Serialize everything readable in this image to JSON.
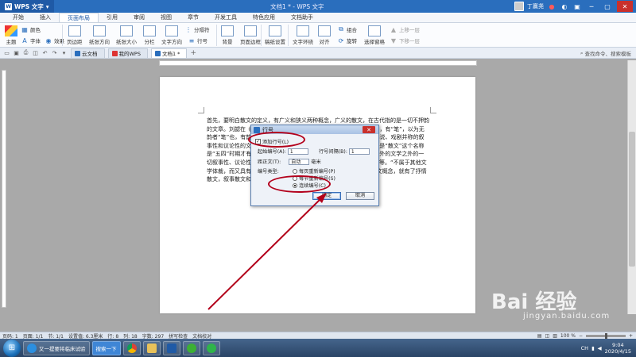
{
  "titlebar": {
    "app_menu_label": "WPS 文字",
    "doc_title": "文档1 * - WPS 文字",
    "user_name": "丁赢尧"
  },
  "menu_tabs": [
    {
      "label": "开始",
      "active": false
    },
    {
      "label": "插入",
      "active": false
    },
    {
      "label": "页面布局",
      "active": true
    },
    {
      "label": "引用",
      "active": false
    },
    {
      "label": "审阅",
      "active": false
    },
    {
      "label": "视图",
      "active": false
    },
    {
      "label": "章节",
      "active": false
    },
    {
      "label": "开发工具",
      "active": false
    },
    {
      "label": "特色应用",
      "active": false
    },
    {
      "label": "文档助手",
      "active": false
    }
  ],
  "ribbon": {
    "color": "颜色",
    "theme": "主题",
    "font": "字体",
    "effect": "效果",
    "margins": "页边距",
    "orientation": "纸张方向",
    "paper_size": "纸张大小",
    "columns": "分栏",
    "text_direction": "文字方向",
    "breaks": "分隔符",
    "line_numbers": "行号",
    "background": "背景",
    "page_border": "页面边框",
    "draft_paper": "稿纸设置",
    "text_wrap": "文字环绕",
    "align": "对齐",
    "group": "组合",
    "rotate": "旋转",
    "selection_pane": "选择窗格",
    "bring_forward": "上移一层",
    "send_backward": "下移一层"
  },
  "tabstrip": {
    "tabs": [
      {
        "label": "云文档"
      },
      {
        "label": "我的WPS"
      },
      {
        "label": "文档1 *"
      }
    ],
    "add_tab": "+",
    "command_search": "查找命令、搜索模板"
  },
  "document": {
    "text": "首先，要明白散文的定义，有广义和狭义两种概念，广义的散文，在古代指的是一切不押韵的文章。刘勰在《文心雕龙》中，将有韵的称为“文”，无韵的称为“笔”，有“笔”，以为无韵者“笔”也，有韵者“文”也。至于近代以来的散文，则多指与诗歌、小说、戏剧并称的叙事性和议论性的文体，这些文体是散文的主要部分。散文中“散”的含义是“散文”这个名称是“五四”时期才有的。在现代，广义的散文是指除诗歌、小说、戏剧以外的文学之外的一切叙事性、议论性、抒情性的文体，包括杂文、小品、随笔、报告文学等。“不属于其他文学体裁，而又具有文学性的散行文章”，狭义的散文则是近代以来的散文概念，就有了抒情散文，叙事散文和议论散文等。"
  },
  "dialog": {
    "title": "行号",
    "add_line_numbers": "添加行号(L)",
    "start_at_label": "起始编号(A):",
    "start_at_value": "1",
    "count_by_label": "行号间隔(B):",
    "count_by_value": "1",
    "from_text_label": "距正文(T):",
    "from_text_value": "自动",
    "from_text_unit": "毫米",
    "numbering_label": "编号类型:",
    "restart_each_page": "每页重新编号(P)",
    "restart_each_section": "每节重新编号(S)",
    "continuous": "连续编号(C)",
    "ok": "确定",
    "cancel": "取消",
    "close": "✕"
  },
  "statusbar": {
    "page_num": "页码: 1",
    "pages": "页面: 1/1",
    "section": "节: 1/1",
    "setting": "设置值: 6.3厘米",
    "row": "行: 8",
    "col": "列: 18",
    "words": "字数: 297",
    "spell": "拼写检查",
    "proof": "文档校对",
    "zoom": "100 %"
  },
  "taskbar": {
    "tasks": [
      {
        "label": "又一提要将临床试验"
      },
      {
        "label": "搜索一下"
      }
    ],
    "lang": "CH",
    "time": "9:04",
    "date": "2020/4/15"
  },
  "watermark": {
    "brand": "Bai 经验",
    "url": "jingyan.baidu.com"
  }
}
